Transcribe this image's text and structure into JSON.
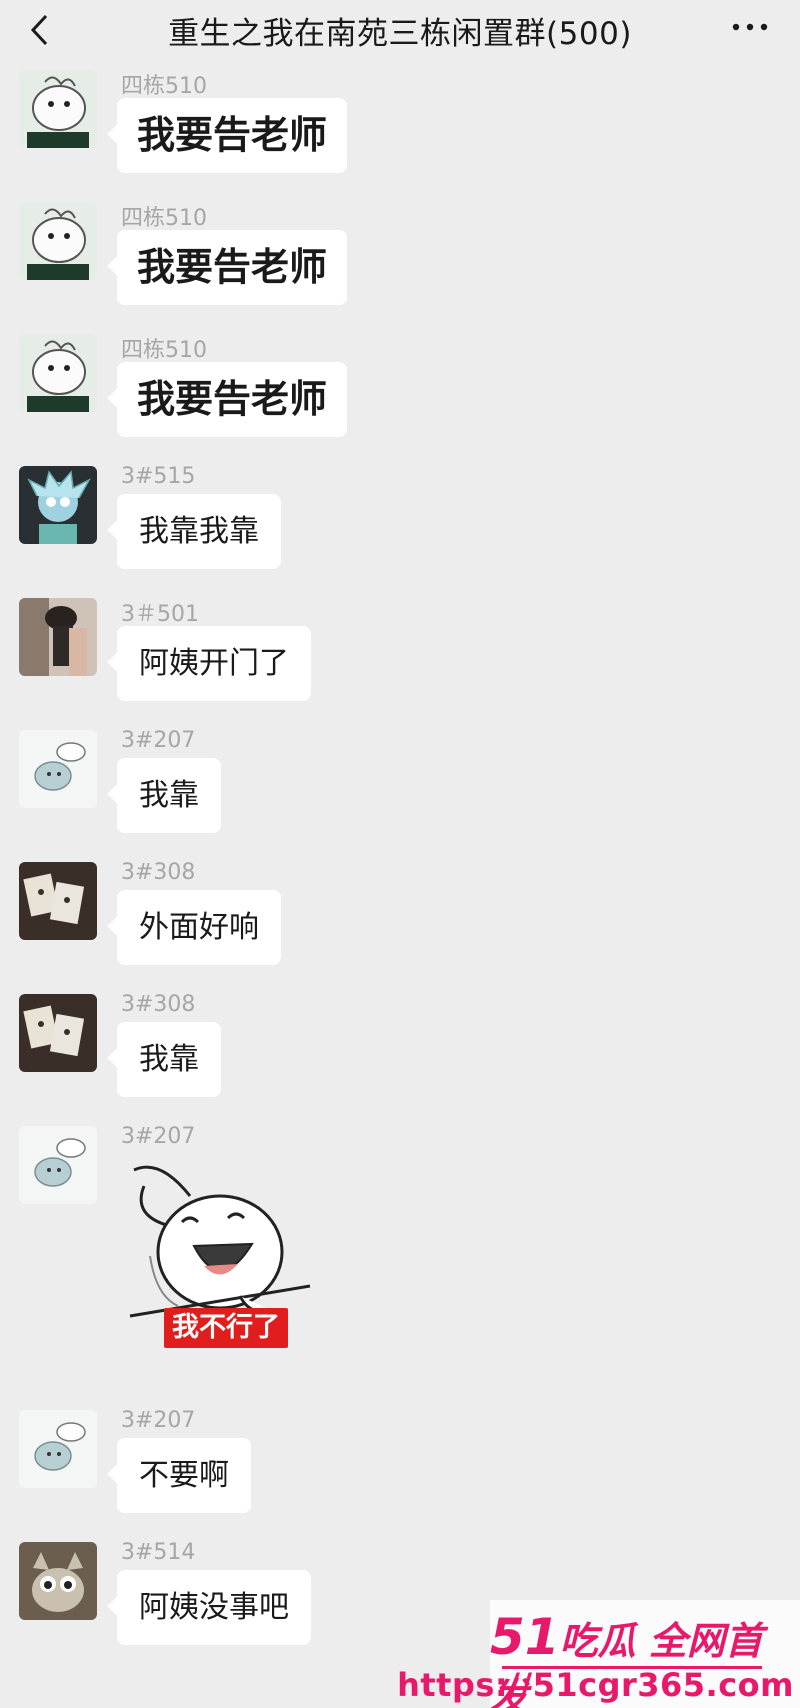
{
  "header": {
    "title": "重生之我在南苑三栋闲置群(500)",
    "back_icon": "chevron-left-icon",
    "more_icon": "more-dots-icon"
  },
  "messages": [
    {
      "sender": "四栋510",
      "text": "我要告老师",
      "style": "big",
      "avatar": "cartoon-avatar"
    },
    {
      "sender": "四栋510",
      "text": "我要告老师",
      "style": "big",
      "avatar": "cartoon-avatar"
    },
    {
      "sender": "四栋510",
      "text": "我要告老师",
      "style": "big",
      "avatar": "cartoon-avatar"
    },
    {
      "sender": "3#515",
      "text": "我靠我靠",
      "style": "normal",
      "avatar": "rick-avatar"
    },
    {
      "sender": "3＃501",
      "text": "阿姨开门了",
      "style": "normal",
      "avatar": "photo-avatar"
    },
    {
      "sender": "3#207",
      "text": "我靠",
      "style": "normal",
      "avatar": "sketch-avatar"
    },
    {
      "sender": "3#308",
      "text": "外面好响",
      "style": "normal",
      "avatar": "cards-avatar"
    },
    {
      "sender": "3#308",
      "text": "我靠",
      "style": "normal",
      "avatar": "cards-avatar"
    },
    {
      "sender": "3#207",
      "sticker_caption": "我不行了",
      "style": "sticker",
      "avatar": "sketch-avatar"
    },
    {
      "sender": "3#207",
      "text": "不要啊",
      "style": "normal",
      "avatar": "sketch-avatar"
    },
    {
      "sender": "3#514",
      "text": "阿姨没事吧",
      "style": "normal",
      "avatar": "creature-avatar"
    }
  ],
  "watermark": {
    "brand_num": "51",
    "brand_text": "吃瓜 全网首发",
    "url": "https://51cgr365.com"
  },
  "colors": {
    "background": "#ededed",
    "bubble": "#ffffff",
    "sticker_caption_bg": "#e01e1e",
    "watermark": "#e8196a"
  }
}
